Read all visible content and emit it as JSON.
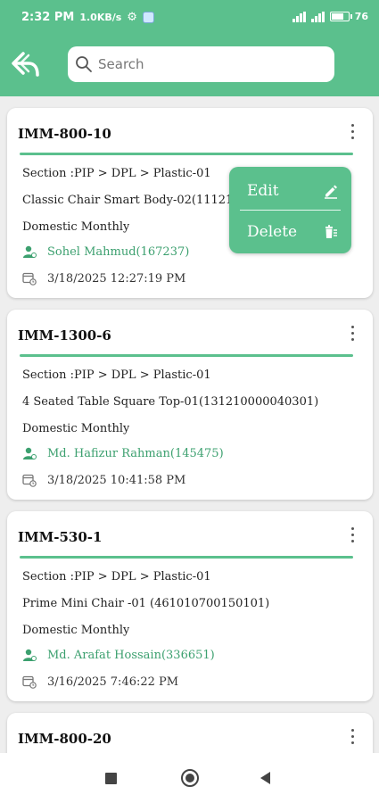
{
  "status_bar": {
    "time": "2:32 PM",
    "speed": "1.0KB/s",
    "battery": "76",
    "battery_level_pct": 76
  },
  "header": {
    "back_icon": "reply-arrow-icon",
    "search": {
      "placeholder": "Search",
      "value": ""
    }
  },
  "cards": [
    {
      "code": "IMM-800-10",
      "section": "Section :PIP > DPL > Plastic-01",
      "product": "Classic Chair Smart Body-02(11121",
      "schedule": "Domestic Monthly",
      "user": "Sohel Mahmud(167237)",
      "date": "3/18/2025 12:27:19 PM"
    },
    {
      "code": "IMM-1300-6",
      "section": "Section :PIP > DPL > Plastic-01",
      "product": "4 Seated Table Square Top-01(131210000040301)",
      "schedule": "Domestic Monthly",
      "user": "Md. Hafizur Rahman(145475)",
      "date": "3/18/2025 10:41:58 PM"
    },
    {
      "code": "IMM-530-1",
      "section": "Section :PIP > DPL > Plastic-01",
      "product": "Prime Mini Chair -01 (461010700150101)",
      "schedule": "Domestic Monthly",
      "user": "Md. Arafat Hossain(336651)",
      "date": "3/16/2025 7:46:22 PM"
    },
    {
      "code": "IMM-800-20"
    }
  ],
  "popup_menu": {
    "edit_label": "Edit",
    "delete_label": "Delete"
  },
  "colors": {
    "accent": "#5bc08d",
    "user_text": "#3ca06f"
  }
}
